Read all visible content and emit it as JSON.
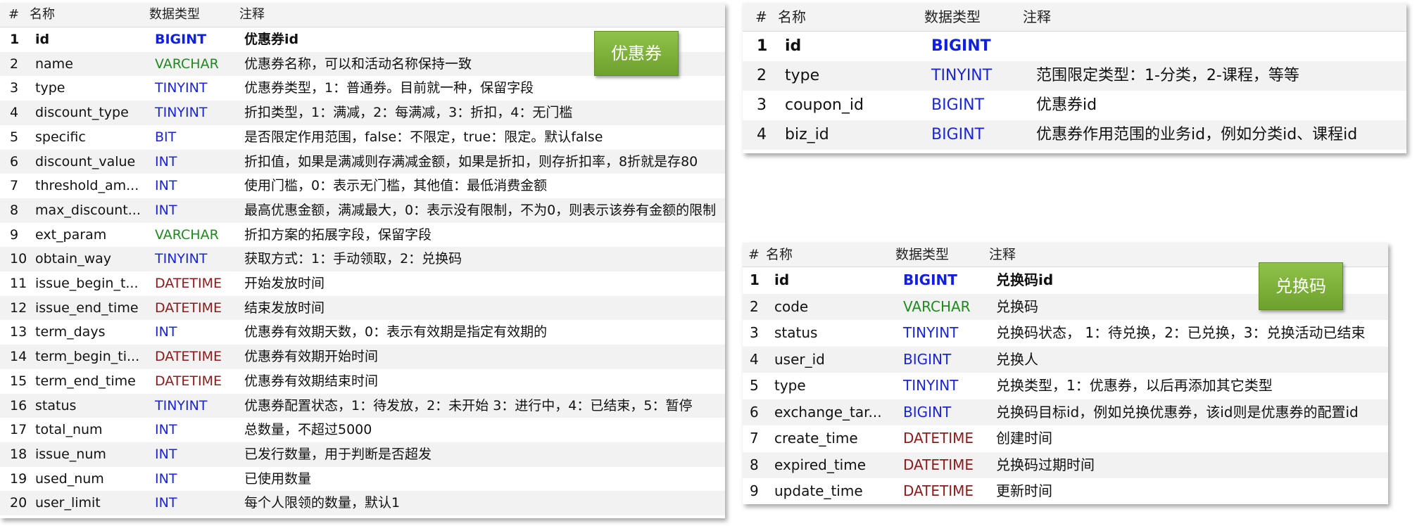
{
  "headers": {
    "num": "#",
    "name": "名称",
    "type": "数据类型",
    "comment": "注释"
  },
  "coupon": {
    "badge": "优惠券",
    "rows": [
      {
        "n": "1",
        "name": "id",
        "type": "BIGINT",
        "comment": "优惠券id"
      },
      {
        "n": "2",
        "name": "name",
        "type": "VARCHAR",
        "comment": "优惠券名称，可以和活动名称保持一致"
      },
      {
        "n": "3",
        "name": "type",
        "type": "TINYINT",
        "comment": "优惠券类型，1：普通券。目前就一种，保留字段"
      },
      {
        "n": "4",
        "name": "discount_type",
        "type": "TINYINT",
        "comment": "折扣类型，1：满减，2：每满减，3：折扣，4：无门槛"
      },
      {
        "n": "5",
        "name": "specific",
        "type": "BIT",
        "comment": "是否限定作用范围，false：不限定，true：限定。默认false"
      },
      {
        "n": "6",
        "name": "discount_value",
        "type": "INT",
        "comment": "折扣值，如果是满减则存满减金额，如果是折扣，则存折扣率，8折就是存80"
      },
      {
        "n": "7",
        "name": "threshold_am...",
        "type": "INT",
        "comment": "使用门槛，0：表示无门槛，其他值：最低消费金额"
      },
      {
        "n": "8",
        "name": "max_discount...",
        "type": "INT",
        "comment": "最高优惠金额，满减最大，0：表示没有限制，不为0，则表示该券有金额的限制"
      },
      {
        "n": "9",
        "name": "ext_param",
        "type": "VARCHAR",
        "comment": "折扣方案的拓展字段，保留字段"
      },
      {
        "n": "10",
        "name": "obtain_way",
        "type": "TINYINT",
        "comment": "获取方式：1：手动领取，2：兑换码"
      },
      {
        "n": "11",
        "name": "issue_begin_t...",
        "type": "DATETIME",
        "comment": "开始发放时间"
      },
      {
        "n": "12",
        "name": "issue_end_time",
        "type": "DATETIME",
        "comment": "结束发放时间"
      },
      {
        "n": "13",
        "name": "term_days",
        "type": "INT",
        "comment": "优惠券有效期天数，0：表示有效期是指定有效期的"
      },
      {
        "n": "14",
        "name": "term_begin_ti...",
        "type": "DATETIME",
        "comment": "优惠券有效期开始时间"
      },
      {
        "n": "15",
        "name": "term_end_time",
        "type": "DATETIME",
        "comment": "优惠券有效期结束时间"
      },
      {
        "n": "16",
        "name": "status",
        "type": "TINYINT",
        "comment": "优惠券配置状态，1：待发放，2：未开始 3：进行中，4：已结束，5：暂停"
      },
      {
        "n": "17",
        "name": "total_num",
        "type": "INT",
        "comment": "总数量，不超过5000"
      },
      {
        "n": "18",
        "name": "issue_num",
        "type": "INT",
        "comment": "已发行数量，用于判断是否超发"
      },
      {
        "n": "19",
        "name": "used_num",
        "type": "INT",
        "comment": "已使用数量"
      },
      {
        "n": "20",
        "name": "user_limit",
        "type": "INT",
        "comment": "每个人限领的数量，默认1"
      }
    ]
  },
  "scope": {
    "rows": [
      {
        "n": "1",
        "name": "id",
        "type": "BIGINT",
        "comment": ""
      },
      {
        "n": "2",
        "name": "type",
        "type": "TINYINT",
        "comment": "范围限定类型：1-分类，2-课程，等等"
      },
      {
        "n": "3",
        "name": "coupon_id",
        "type": "BIGINT",
        "comment": "优惠券id"
      },
      {
        "n": "4",
        "name": "biz_id",
        "type": "BIGINT",
        "comment": "优惠券作用范围的业务id，例如分类id、课程id"
      }
    ]
  },
  "exchange": {
    "badge": "兑换码",
    "rows": [
      {
        "n": "1",
        "name": "id",
        "type": "BIGINT",
        "comment": "兑换码id"
      },
      {
        "n": "2",
        "name": "code",
        "type": "VARCHAR",
        "comment": "兑换码"
      },
      {
        "n": "3",
        "name": "status",
        "type": "TINYINT",
        "comment": "兑换码状态， 1：待兑换，2：已兑换，3：兑换活动已结束"
      },
      {
        "n": "4",
        "name": "user_id",
        "type": "BIGINT",
        "comment": "兑换人"
      },
      {
        "n": "5",
        "name": "type",
        "type": "TINYINT",
        "comment": "兑换类型，1：优惠券，以后再添加其它类型"
      },
      {
        "n": "6",
        "name": "exchange_tar...",
        "type": "BIGINT",
        "comment": "兑换码目标id，例如兑换优惠券，该id则是优惠券的配置id"
      },
      {
        "n": "7",
        "name": "create_time",
        "type": "DATETIME",
        "comment": "创建时间"
      },
      {
        "n": "8",
        "name": "expired_time",
        "type": "DATETIME",
        "comment": "兑换码过期时间"
      },
      {
        "n": "9",
        "name": "update_time",
        "type": "DATETIME",
        "comment": "更新时间"
      }
    ]
  }
}
